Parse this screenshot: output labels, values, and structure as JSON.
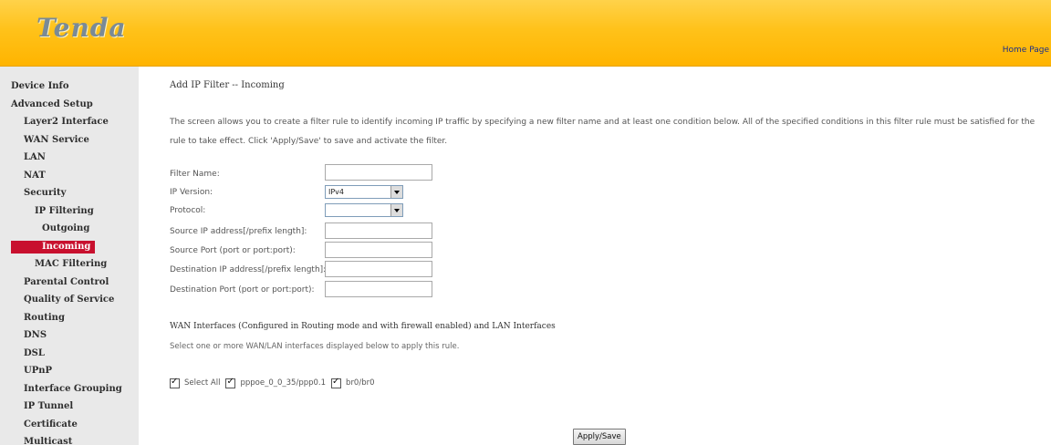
{
  "header": {
    "logo_text": "Tenda",
    "home_link": "Home Page",
    "colors": {
      "header_top": "#ffd24a",
      "header_bottom": "#ffb400",
      "logo": "#7a8a96"
    }
  },
  "sidebar": {
    "items": [
      {
        "label": "Device Info",
        "level": 0
      },
      {
        "label": "Advanced Setup",
        "level": 0
      },
      {
        "label": "Layer2 Interface",
        "level": 1
      },
      {
        "label": "WAN Service",
        "level": 1
      },
      {
        "label": "LAN",
        "level": 1
      },
      {
        "label": "NAT",
        "level": 1
      },
      {
        "label": "Security",
        "level": 1
      },
      {
        "label": "IP Filtering",
        "level": 2
      },
      {
        "label": "Outgoing",
        "level": 3
      },
      {
        "label": "Incoming",
        "level": 3,
        "active": true
      },
      {
        "label": "MAC Filtering",
        "level": 2
      },
      {
        "label": "Parental Control",
        "level": 1
      },
      {
        "label": "Quality of Service",
        "level": 1
      },
      {
        "label": "Routing",
        "level": 1
      },
      {
        "label": "DNS",
        "level": 1
      },
      {
        "label": "DSL",
        "level": 1
      },
      {
        "label": "UPnP",
        "level": 1
      },
      {
        "label": "Interface Grouping",
        "level": 1
      },
      {
        "label": "IP Tunnel",
        "level": 1
      },
      {
        "label": "Certificate",
        "level": 1
      },
      {
        "label": "Multicast",
        "level": 1
      }
    ],
    "active_color": "#c8102e"
  },
  "main": {
    "title": "Add IP Filter -- Incoming",
    "description": "The screen allows you to create a filter rule to identify incoming IP traffic by specifying a new filter name and at least one condition below. All of the specified conditions in this filter rule must be satisfied for the rule to take effect. Click 'Apply/Save' to save and activate the filter.",
    "form": {
      "filter_name_label": "Filter Name:",
      "filter_name_value": "",
      "ip_version_label": "IP Version:",
      "ip_version_value": "IPv4",
      "protocol_label": "Protocol:",
      "protocol_value": "",
      "source_ip_label": "Source IP address[/prefix length]:",
      "source_ip_value": "",
      "source_port_label": "Source Port (port or port:port):",
      "source_port_value": "",
      "dest_ip_label": "Destination IP address[/prefix length]:",
      "dest_ip_value": "",
      "dest_port_label": "Destination Port (port or port:port):",
      "dest_port_value": ""
    },
    "wan": {
      "title": "WAN Interfaces (Configured in Routing mode and with firewall enabled) and LAN Interfaces",
      "description": "Select one or more WAN/LAN interfaces displayed below to apply this rule.",
      "select_all_label": "Select All",
      "iface_1_label": "pppoe_0_0_35/ppp0.1",
      "iface_2_label": "br0/br0"
    },
    "apply_label": "Apply/Save"
  }
}
